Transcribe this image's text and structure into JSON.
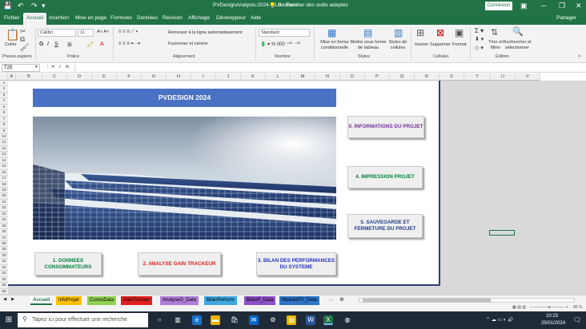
{
  "titlebar": {
    "title": "PVDesignAnalysis-2024-V1.0  -  Excel",
    "search": "Rechercher des outils adaptés",
    "connexion": "Connexion"
  },
  "tabs": [
    "Fichier",
    "Accueil",
    "Insertion",
    "Mise en page",
    "Formules",
    "Données",
    "Révision",
    "Affichage",
    "Développeur",
    "Aide"
  ],
  "share": "Partager",
  "ribbon": {
    "clipboard": {
      "paste": "Coller",
      "label": "Presse-papiers"
    },
    "font": {
      "name": "Calibri",
      "size": "11",
      "label": "Police"
    },
    "alignment": {
      "wrap": "Renvoyer à la ligne automatiquement",
      "merge": "Fusionner et centrer",
      "label": "Alignement"
    },
    "number": {
      "format": "Standard",
      "label": "Nombre"
    },
    "styles": {
      "cond_format": "Mise en forme conditionnelle",
      "table_format": "Mettre sous forme de tableau",
      "cell_styles": "Styles de cellules",
      "label": "Styles"
    },
    "cells": {
      "insert": "Insérer",
      "delete": "Supprimer",
      "format": "Format",
      "label": "Cellules"
    },
    "editing": {
      "sort": "Trier et filtrer",
      "find": "Rechercher et sélectionner",
      "label": "Édition"
    }
  },
  "formula_bar": {
    "name_box": "T25",
    "fx": "fx"
  },
  "columns": [
    "A",
    "B",
    "C",
    "D",
    "E",
    "F",
    "G",
    "H",
    "I",
    "J",
    "K",
    "L",
    "M",
    "N",
    "O",
    "P",
    "Q",
    "R",
    "S",
    "T",
    "U",
    "V"
  ],
  "rows": [
    "1",
    "2",
    "3",
    "4",
    "5",
    "6",
    "7",
    "8",
    "9",
    "10",
    "11",
    "12",
    "13",
    "14",
    "15",
    "16",
    "17",
    "18",
    "19",
    "20",
    "21",
    "22",
    "23",
    "24",
    "25",
    "26",
    "27",
    "28",
    "29",
    "30",
    "31",
    "32",
    "33",
    "34",
    "35",
    "36"
  ],
  "sheet": {
    "banner": "PVDESIGN 2024",
    "buttons": {
      "info": "0. INFORMATIONS DU PROJET",
      "print": "4. IMPRESSION PROJET",
      "save": "5. SAUVEGARDE ET FERMETURE DU PROJET",
      "consumers": "1. DONNEES CONSOMMATEURS",
      "tracker": "2. ANALYSE GAIN TRACKEUR",
      "perf": "3. BILAN DES PERFORMANCES DU SYSTEME"
    },
    "button_colors": {
      "info": "#7030a0",
      "print": "#00803c",
      "save": "#1f3d8a",
      "consumers": "#00803c",
      "tracker": "#e02020",
      "perf": "#2030c0"
    }
  },
  "sheet_tabs": [
    {
      "label": "Accueil",
      "color": "#ffffff"
    },
    {
      "label": "InfoProjet",
      "color": "#ffc000"
    },
    {
      "label": "ConsoData",
      "color": "#92d050"
    },
    {
      "label": "GainTracker",
      "color": "#e02020"
    },
    {
      "label": "AnalyseG_Data",
      "color": "#b07cd8"
    },
    {
      "label": "BilanPerform",
      "color": "#3fa7e0"
    },
    {
      "label": "BilanP_Data",
      "color": "#8e4fc8"
    },
    {
      "label": "ModulePV_Data",
      "color": "#2e74c5"
    }
  ],
  "sheet_tabs_more": "...",
  "status": {
    "zoom": "80 %"
  },
  "taskbar": {
    "search_placeholder": "Tapez ici pour effectuer une recherche",
    "time": "10:23",
    "date": "25/01/2024"
  }
}
